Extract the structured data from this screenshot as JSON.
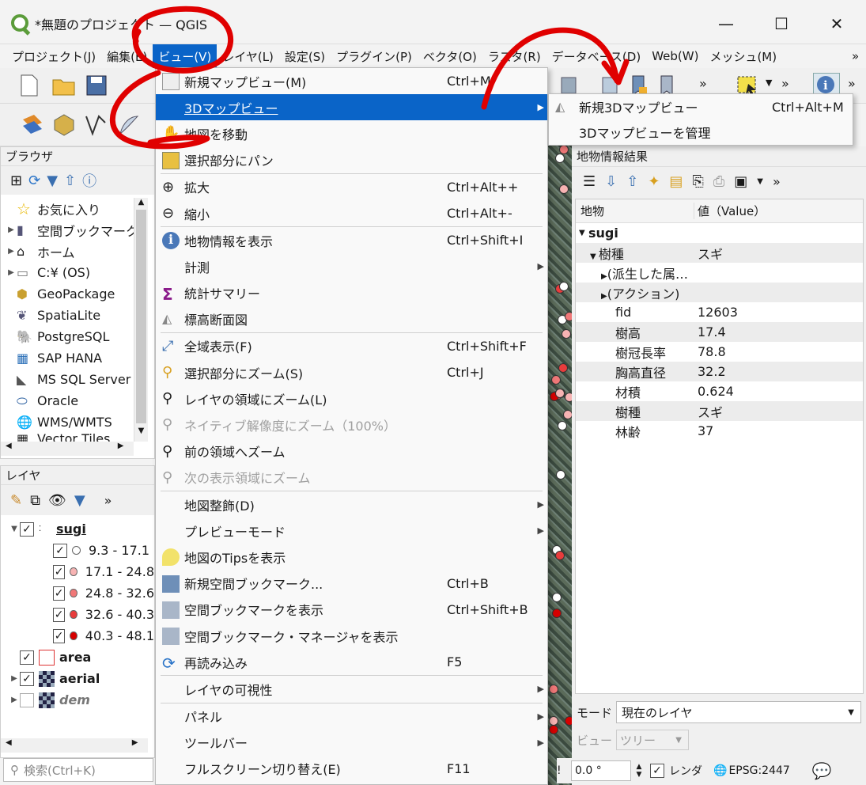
{
  "window": {
    "title": "*無題のプロジェクト — QGIS",
    "minimize": "—",
    "maximize": "☐",
    "close": "✕"
  },
  "menubar": {
    "items": [
      "プロジェクト(J)",
      "編集(E)",
      "ビュー(V)",
      "レイヤ(L)",
      "設定(S)",
      "プラグイン(P)",
      "ベクタ(O)",
      "ラスタ(R)",
      "データベース(D)",
      "Web(W)",
      "メッシュ(M)"
    ],
    "more": "»"
  },
  "view_menu": {
    "items": [
      {
        "label": "新規マップビュー(M)",
        "shortcut": "Ctrl+M",
        "icon": "new-map-view-icon"
      },
      {
        "label": "3Dマップビュー",
        "shortcut": "",
        "submenu": true,
        "highlighted": true
      },
      {
        "label": "地図を移動",
        "shortcut": "",
        "icon": "pan-hand-icon"
      },
      {
        "label": "選択部分にパン",
        "shortcut": "",
        "icon": "pan-selection-icon"
      },
      {
        "label": "拡大",
        "shortcut": "Ctrl+Alt++",
        "icon": "zoom-in-icon"
      },
      {
        "label": "縮小",
        "shortcut": "Ctrl+Alt+-",
        "icon": "zoom-out-icon"
      },
      {
        "label": "地物情報を表示",
        "shortcut": "Ctrl+Shift+I",
        "icon": "identify-icon"
      },
      {
        "label": "計測",
        "shortcut": "",
        "submenu": true
      },
      {
        "label": "統計サマリー",
        "shortcut": "",
        "icon": "sigma-icon"
      },
      {
        "label": "標高断面図",
        "shortcut": "",
        "icon": "elevation-profile-icon"
      },
      {
        "label": "全域表示(F)",
        "shortcut": "Ctrl+Shift+F",
        "icon": "zoom-full-icon"
      },
      {
        "label": "選択部分にズーム(S)",
        "shortcut": "Ctrl+J",
        "icon": "zoom-selection-icon"
      },
      {
        "label": "レイヤの領域にズーム(L)",
        "shortcut": "",
        "icon": "zoom-layer-icon"
      },
      {
        "label": "ネイティブ解像度にズーム（100%）",
        "shortcut": "",
        "disabled": true,
        "icon": "zoom-native-icon"
      },
      {
        "label": "前の領域へズーム",
        "shortcut": "",
        "icon": "zoom-last-icon"
      },
      {
        "label": "次の表示領域にズーム",
        "shortcut": "",
        "disabled": true,
        "icon": "zoom-next-icon"
      },
      {
        "label": "地図整飾(D)",
        "shortcut": "",
        "submenu": true
      },
      {
        "label": "プレビューモード",
        "shortcut": "",
        "submenu": true
      },
      {
        "label": "地図のTipsを表示",
        "shortcut": "",
        "icon": "map-tips-icon"
      },
      {
        "label": "新規空間ブックマーク...",
        "shortcut": "Ctrl+B",
        "icon": "new-bookmark-icon"
      },
      {
        "label": "空間ブックマークを表示",
        "shortcut": "Ctrl+Shift+B",
        "icon": "bookmark-icon"
      },
      {
        "label": "空間ブックマーク・マネージャを表示",
        "shortcut": "",
        "icon": "bookmark-manager-icon"
      },
      {
        "label": "再読み込み",
        "shortcut": "F5",
        "icon": "refresh-icon"
      },
      {
        "label": "レイヤの可視性",
        "shortcut": "",
        "submenu": true
      },
      {
        "label": "パネル",
        "shortcut": "",
        "submenu": true
      },
      {
        "label": "ツールバー",
        "shortcut": "",
        "submenu": true
      },
      {
        "label": "フルスクリーン切り替え(E)",
        "shortcut": "F11"
      }
    ]
  },
  "submenu_3d": {
    "items": [
      {
        "label": "新規3Dマップビュー",
        "shortcut": "Ctrl+Alt+M"
      },
      {
        "label": "3Dマップビューを管理",
        "shortcut": ""
      }
    ]
  },
  "browser": {
    "title": "ブラウザ",
    "items": [
      "お気に入り",
      "空間ブックマーク",
      "ホーム",
      "C:¥ (OS)",
      "GeoPackage",
      "SpatiaLite",
      "PostgreSQL",
      "SAP HANA",
      "MS SQL Server",
      "Oracle",
      "WMS/WMTS",
      "Vector Tiles"
    ]
  },
  "layers": {
    "title": "レイヤ",
    "items": [
      {
        "name": "sugi",
        "bold": true,
        "underline": true
      },
      {
        "name": "9.3 - 17.1",
        "color": "#ffffff"
      },
      {
        "name": "17.1 - 24.8",
        "color": "#f7b3b3"
      },
      {
        "name": "24.8 - 32.6",
        "color": "#f07878"
      },
      {
        "name": "32.6 - 40.3",
        "color": "#e83c3c"
      },
      {
        "name": "40.3 - 48.1",
        "color": "#d60000"
      },
      {
        "name": "area",
        "bold": true
      },
      {
        "name": "aerial",
        "bold": true
      },
      {
        "name": "dem",
        "italic": true
      }
    ]
  },
  "search": {
    "placeholder": "検索(Ctrl+K)"
  },
  "identify": {
    "title": "地物情報結果",
    "col_feature": "地物",
    "col_value": "値（Value）",
    "layer": "sugi",
    "feature_label": "樹種",
    "feature_value": "スギ",
    "derived": "(派生した属…",
    "actions": "(アクション)",
    "attributes": [
      {
        "k": "fid",
        "v": "12603"
      },
      {
        "k": "樹高",
        "v": "17.4"
      },
      {
        "k": "樹冠長率",
        "v": "78.8"
      },
      {
        "k": "胸高直径",
        "v": "32.2"
      },
      {
        "k": "材積",
        "v": "0.624"
      },
      {
        "k": "樹種",
        "v": "スギ"
      },
      {
        "k": "林齢",
        "v": "37"
      }
    ],
    "mode_label": "モード",
    "mode_value": "現在のレイヤ",
    "view_label": "ビュー",
    "view_value": "ツリー"
  },
  "statusbar": {
    "rotation": "0.0 °",
    "render": "レンダ",
    "crs": "EPSG:2447"
  },
  "colors": {
    "accent": "#0a64c8",
    "annotation": "#e00000"
  }
}
